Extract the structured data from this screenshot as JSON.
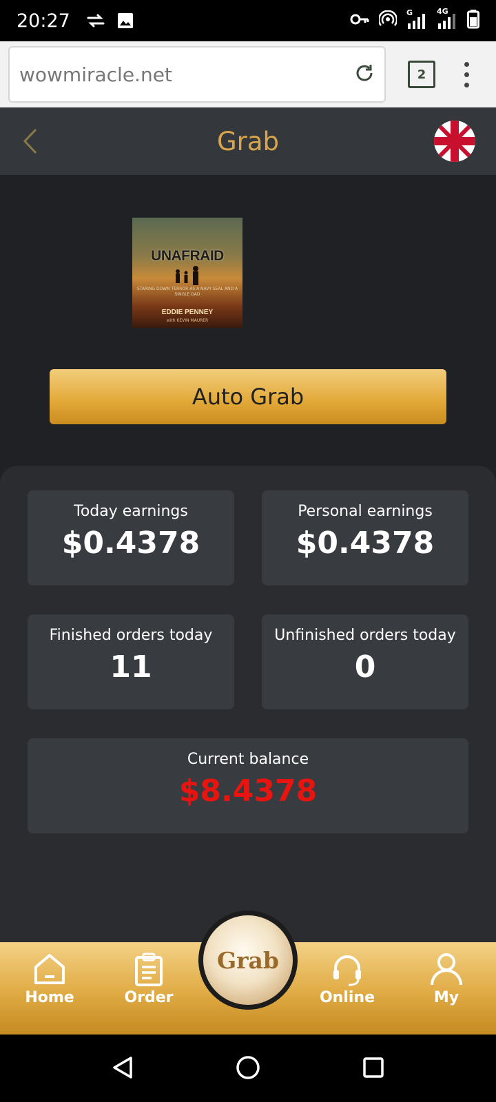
{
  "status_bar": {
    "time": "20:27",
    "network_labels": [
      "G",
      "4G"
    ]
  },
  "browser": {
    "url": "wowmiracle.net",
    "tab_count": "2"
  },
  "header": {
    "title": "Grab"
  },
  "product": {
    "title": "UNAFRAID",
    "tagline": "STARING DOWN TERROR AS A NAVY SEAL AND A SINGLE DAD",
    "author": "EDDIE PENNEY",
    "coauthor": "with KEVIN MAURER"
  },
  "auto_grab_label": "Auto Grab",
  "stats": {
    "today_earnings": {
      "label": "Today earnings",
      "value": "$0.4378"
    },
    "personal_earnings": {
      "label": "Personal earnings",
      "value": "$0.4378"
    },
    "finished_orders": {
      "label": "Finished orders today",
      "value": "11"
    },
    "unfinished_orders": {
      "label": "Unfinished orders today",
      "value": "0"
    },
    "current_balance": {
      "label": "Current balance",
      "value": "$8.4378"
    }
  },
  "bottom_nav": {
    "home": "Home",
    "order": "Order",
    "grab": "Grab",
    "online": "Online",
    "my": "My"
  },
  "colors": {
    "accent_gold": "#d9a54a",
    "balance_red": "#e8140f",
    "background": "#1f2124",
    "card": "#383b40"
  }
}
